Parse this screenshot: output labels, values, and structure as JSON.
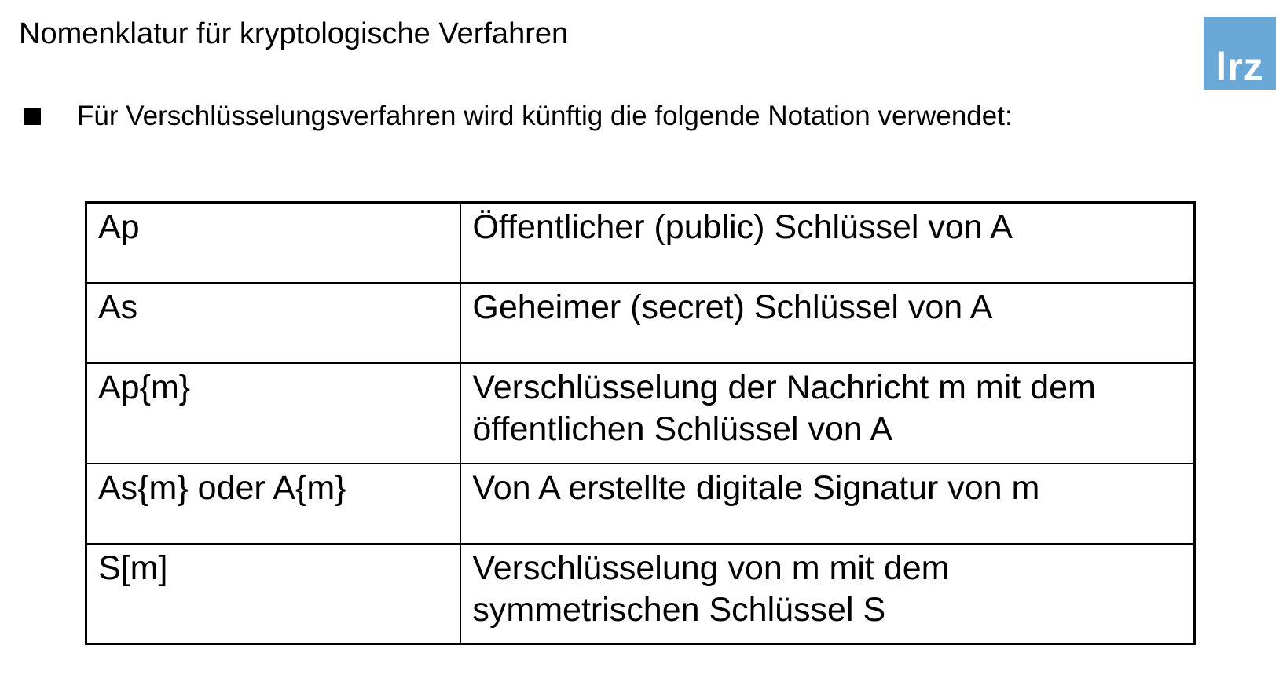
{
  "title": "Nomenklatur für kryptologische Verfahren",
  "logo": {
    "text": "lrz",
    "color": "#6aa8d8"
  },
  "bullet": {
    "icon": "square-bullet-icon",
    "text": "Für Verschlüsselungsverfahren wird künftig die folgende Notation verwendet:"
  },
  "table": {
    "rows": [
      {
        "symbol": "Ap",
        "meaning": "Öffentlicher (public) Schlüssel von A"
      },
      {
        "symbol": "As",
        "meaning": "Geheimer (secret) Schlüssel von A"
      },
      {
        "symbol": "Ap{m}",
        "meaning": "Verschlüsselung der Nachricht m mit dem öffentlichen Schlüssel von A"
      },
      {
        "symbol": "As{m} oder A{m}",
        "meaning": "Von A erstellte digitale Signatur von m"
      },
      {
        "symbol": "S[m]",
        "meaning": "Verschlüsselung von m mit dem symmetrischen Schlüssel S"
      }
    ]
  }
}
